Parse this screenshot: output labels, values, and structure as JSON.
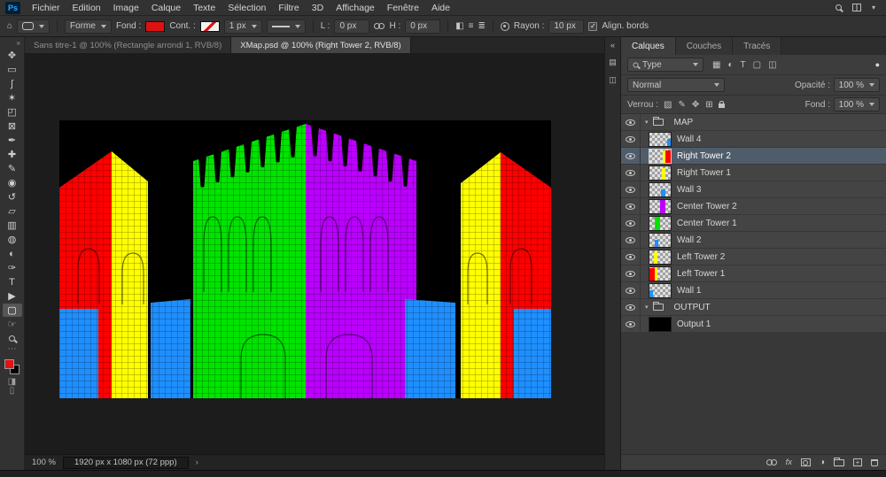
{
  "menubar": {
    "logo": "Ps",
    "items": [
      "Fichier",
      "Edition",
      "Image",
      "Calque",
      "Texte",
      "Sélection",
      "Filtre",
      "3D",
      "Affichage",
      "Fenêtre",
      "Aide"
    ]
  },
  "icons": {
    "home": "⌂",
    "collapse": "»",
    "expand": "«",
    "more": "⋯",
    "quick_mask": "◨",
    "screen_mode": "▯",
    "path_ops": "◧",
    "path_align": "≡",
    "path_arrange": "≣",
    "filter_toggle": "●",
    "fx": "fx",
    "adjustment": "◑",
    "panel1": "▤",
    "panel2": "◫",
    "menubar_chevron": "▾",
    "group_chevron": "▾",
    "chevron_small": "›",
    "check": "✓"
  },
  "options": {
    "mode": "Forme",
    "fill_label": "Fond :",
    "fill_color": "#dd1111",
    "stroke_label": "Cont. :",
    "stroke_color": "#dd1111",
    "stroke_width": "1 px",
    "width_label": "L :",
    "width_value": "0 px",
    "height_label": "H :",
    "height_value": "0 px",
    "radius_label": "Rayon :",
    "radius_value": "10 px",
    "align_edges_label": "Align. bords"
  },
  "tabs": [
    {
      "label": "Sans titre-1 @ 100% (Rectangle arrondi 1, RVB/8)",
      "active": false
    },
    {
      "label": "XMap.psd @ 100% (Right Tower 2, RVB/8)",
      "active": true
    }
  ],
  "toolbar": {
    "fg_color": "#e01212",
    "bg_color": "#000000",
    "tools": [
      {
        "name": "move-tool",
        "glyph": "✥"
      },
      {
        "name": "marquee-tool",
        "glyph": "▭"
      },
      {
        "name": "lasso-tool",
        "glyph": "ʃ"
      },
      {
        "name": "quick-selection-tool",
        "glyph": "✶"
      },
      {
        "name": "crop-tool",
        "glyph": "◰"
      },
      {
        "name": "frame-tool",
        "glyph": "⊠"
      },
      {
        "name": "eyedropper-tool",
        "glyph": "✒"
      },
      {
        "name": "healing-brush-tool",
        "glyph": "✚"
      },
      {
        "name": "brush-tool",
        "glyph": "✎"
      },
      {
        "name": "clone-stamp-tool",
        "glyph": "◉"
      },
      {
        "name": "history-brush-tool",
        "glyph": "↺"
      },
      {
        "name": "eraser-tool",
        "glyph": "▱"
      },
      {
        "name": "gradient-tool",
        "glyph": "▥"
      },
      {
        "name": "blur-tool",
        "glyph": "◍"
      },
      {
        "name": "dodge-tool",
        "glyph": "◐"
      },
      {
        "name": "pen-tool",
        "glyph": "✑"
      },
      {
        "name": "type-tool",
        "glyph": "T"
      },
      {
        "name": "path-selection-tool",
        "glyph": "▶"
      },
      {
        "name": "shape-tool",
        "glyph": "▢",
        "active": true
      },
      {
        "name": "hand-tool",
        "glyph": "☞"
      },
      {
        "name": "zoom-tool",
        "css": "mag"
      }
    ]
  },
  "canvas": {
    "colors": {
      "background": "#000000",
      "red": "#ff0000",
      "yellow": "#ffff00",
      "green": "#00e400",
      "magenta": "#bb00ff",
      "blue": "#1f8fff"
    }
  },
  "panel": {
    "tabs": [
      "Calques",
      "Couches",
      "Tracés"
    ],
    "search_type": "Type",
    "filter_icons": [
      {
        "name": "filter-pixel-icon",
        "glyph": "▦"
      },
      {
        "name": "filter-adjustment-icon",
        "glyph": "◐"
      },
      {
        "name": "filter-type-icon",
        "glyph": "T"
      },
      {
        "name": "filter-shape-icon",
        "glyph": "▢"
      },
      {
        "name": "filter-smart-object-icon",
        "glyph": "◫"
      }
    ],
    "blend_mode": "Normal",
    "opacity_label": "Opacité :",
    "opacity_value": "100 %",
    "lock_label": "Verrou :",
    "lock_icons": [
      {
        "name": "lock-transparency-icon",
        "glyph": "▨"
      },
      {
        "name": "lock-pixels-icon",
        "glyph": "✎"
      },
      {
        "name": "lock-position-icon",
        "glyph": "✥"
      },
      {
        "name": "lock-artboard-icon",
        "glyph": "⊞"
      }
    ],
    "fill_label": "Fond :",
    "fill_value": "100 %",
    "layers": [
      {
        "name": "MAP",
        "kind": "group"
      },
      {
        "name": "Wall 4",
        "kind": "layer",
        "thumb": {
          "bg": "checker",
          "blocks": [
            {
              "c": "#1f8fff",
              "l": 20,
              "w": 4,
              "t": 7,
              "h": 8
            }
          ]
        }
      },
      {
        "name": "Right Tower 2",
        "kind": "layer",
        "selected": true,
        "thumb": {
          "bg": "checker",
          "blocks": [
            {
              "c": "#ffff00",
              "l": 15,
              "w": 3,
              "t": 1,
              "h": 14
            },
            {
              "c": "#ff0000",
              "l": 18,
              "w": 6,
              "t": 1,
              "h": 14
            }
          ]
        }
      },
      {
        "name": "Right Tower 1",
        "kind": "layer",
        "thumb": {
          "bg": "checker",
          "blocks": [
            {
              "c": "#ffff00",
              "l": 14,
              "w": 4,
              "t": 2,
              "h": 13
            }
          ]
        }
      },
      {
        "name": "Wall 3",
        "kind": "layer",
        "thumb": {
          "bg": "checker",
          "blocks": [
            {
              "c": "#1f8fff",
              "l": 13,
              "w": 5,
              "t": 7,
              "h": 8
            }
          ]
        }
      },
      {
        "name": "Center Tower 2",
        "kind": "layer",
        "thumb": {
          "bg": "checker",
          "blocks": [
            {
              "c": "#bb00ff",
              "l": 12,
              "w": 6,
              "t": 0,
              "h": 15
            }
          ]
        }
      },
      {
        "name": "Center Tower 1",
        "kind": "layer",
        "thumb": {
          "bg": "checker",
          "blocks": [
            {
              "c": "#00e400",
              "l": 6,
              "w": 6,
              "t": 0,
              "h": 15
            }
          ]
        }
      },
      {
        "name": "Wall 2",
        "kind": "layer",
        "thumb": {
          "bg": "checker",
          "blocks": [
            {
              "c": "#1f8fff",
              "l": 6,
              "w": 4,
              "t": 7,
              "h": 8
            }
          ]
        }
      },
      {
        "name": "Left Tower 2",
        "kind": "layer",
        "thumb": {
          "bg": "checker",
          "blocks": [
            {
              "c": "#ffff00",
              "l": 5,
              "w": 4,
              "t": 2,
              "h": 13
            }
          ]
        }
      },
      {
        "name": "Left Tower 1",
        "kind": "layer",
        "thumb": {
          "bg": "checker",
          "blocks": [
            {
              "c": "#ff0000",
              "l": 0,
              "w": 6,
              "t": 1,
              "h": 14
            },
            {
              "c": "#ffff00",
              "l": 6,
              "w": 3,
              "t": 1,
              "h": 14
            }
          ]
        }
      },
      {
        "name": "Wall 1",
        "kind": "layer",
        "thumb": {
          "bg": "checker",
          "blocks": [
            {
              "c": "#1f8fff",
              "l": 0,
              "w": 4,
              "t": 7,
              "h": 8
            }
          ]
        }
      },
      {
        "name": "OUTPUT",
        "kind": "group"
      },
      {
        "name": "Output 1",
        "kind": "layer",
        "thumb": {
          "bg": "#000000",
          "blocks": []
        }
      }
    ]
  },
  "statusbar": {
    "zoom": "100 %",
    "dimensions": "1920 px x 1080 px (72 ppp)"
  }
}
